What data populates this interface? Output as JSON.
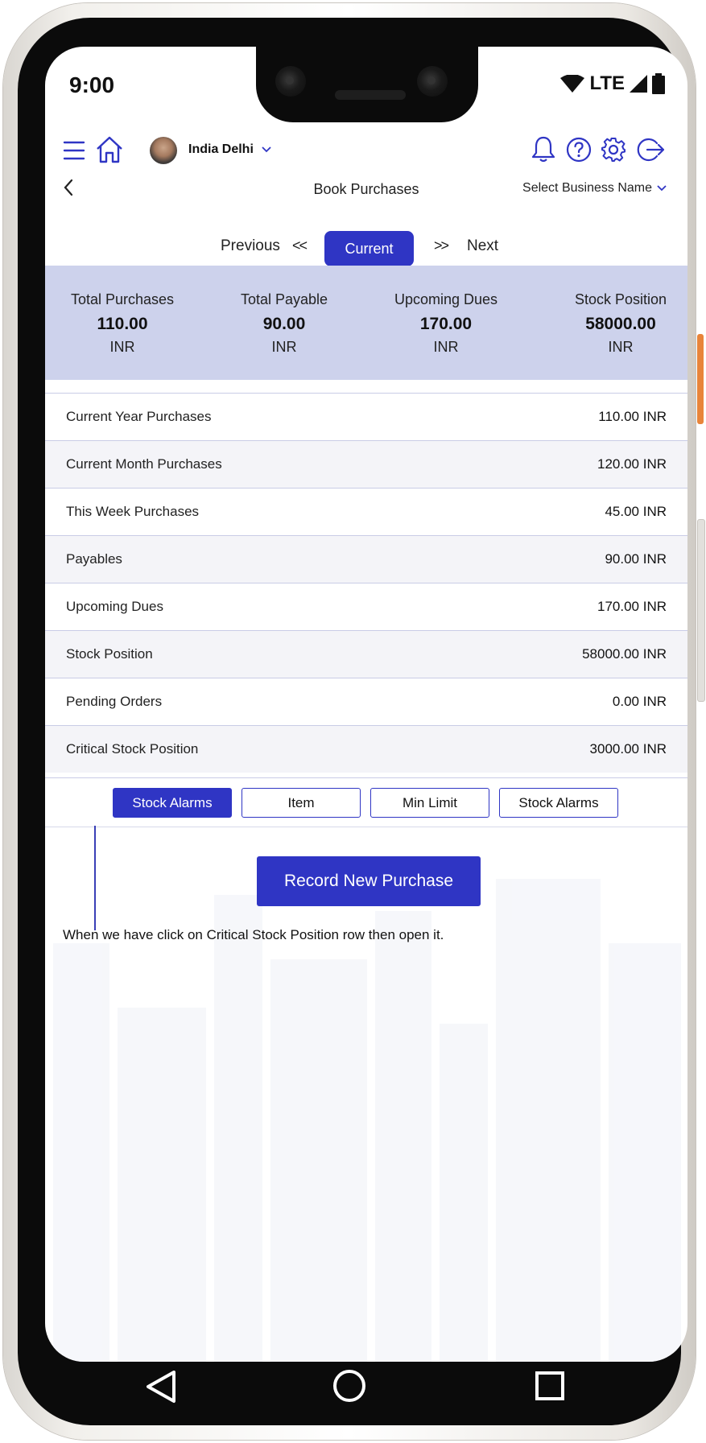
{
  "status_bar": {
    "time": "9:00",
    "network": "LTE"
  },
  "header": {
    "user_name": "India Delhi"
  },
  "page": {
    "title": "Book Purchases",
    "business_select": "Select Business Name"
  },
  "pager": {
    "previous": "Previous",
    "prev_arrows": "<<",
    "current": "Current",
    "next_arrows": ">>",
    "next": "Next"
  },
  "summary": [
    {
      "label": "Total Purchases",
      "value": "110.00",
      "currency": "INR"
    },
    {
      "label": "Total Payable",
      "value": "90.00",
      "currency": "INR"
    },
    {
      "label": "Upcoming Dues",
      "value": "170.00",
      "currency": "INR"
    },
    {
      "label": "Stock Position",
      "value": "58000.00",
      "currency": "INR"
    }
  ],
  "rows": [
    {
      "label": "Current Year Purchases",
      "amount": "110.00 INR"
    },
    {
      "label": "Current Month Purchases",
      "amount": "120.00 INR"
    },
    {
      "label": "This Week Purchases",
      "amount": "45.00 INR"
    },
    {
      "label": "Payables",
      "amount": "90.00 INR"
    },
    {
      "label": "Upcoming Dues",
      "amount": "170.00 INR"
    },
    {
      "label": "Stock Position",
      "amount": "58000.00 INR"
    },
    {
      "label": "Pending Orders",
      "amount": "0.00 INR"
    },
    {
      "label": "Critical Stock Position",
      "amount": "3000.00 INR"
    }
  ],
  "tabs": [
    "Stock Alarms",
    "Item",
    "Min Limit",
    "Stock Alarms"
  ],
  "actions": {
    "record_new_purchase": "Record New Purchase"
  },
  "note": "When we have click on Critical Stock Position row  then open it.",
  "colors": {
    "accent": "#2f35c4",
    "summary_bg": "#cdd2ec",
    "row_alt": "#f4f4f8"
  }
}
